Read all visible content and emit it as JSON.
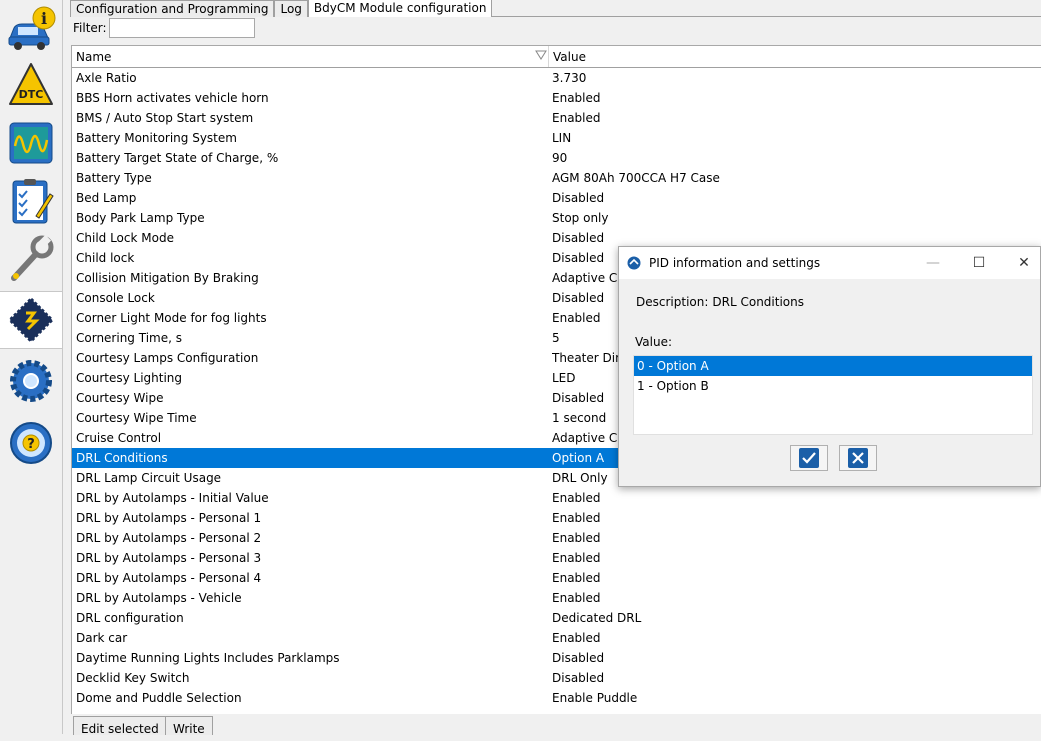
{
  "toolbar": {
    "items": [
      {
        "icon": "vehicle-info-icon"
      },
      {
        "icon": "dtc-icon",
        "label": "DTC"
      },
      {
        "icon": "oscilloscope-icon"
      },
      {
        "icon": "checklist-icon"
      },
      {
        "icon": "wrench-icon"
      },
      {
        "icon": "module-config-icon",
        "active": true
      },
      {
        "icon": "settings-gear-icon"
      },
      {
        "icon": "help-wheel-icon",
        "label": "?"
      }
    ]
  },
  "tabs": [
    {
      "label": "Configuration and Programming"
    },
    {
      "label": "Log"
    },
    {
      "label": "BdyCM Module configuration",
      "active": true
    }
  ],
  "filter": {
    "label": "Filter:",
    "value": ""
  },
  "table": {
    "columns": {
      "name": "Name",
      "value": "Value"
    },
    "rows": [
      {
        "name": "Axle Ratio",
        "value": "3.730"
      },
      {
        "name": "BBS Horn activates vehicle horn",
        "value": "Enabled"
      },
      {
        "name": "BMS / Auto Stop Start system",
        "value": "Enabled"
      },
      {
        "name": "Battery Monitoring System",
        "value": "LIN"
      },
      {
        "name": "Battery Target State of Charge, %",
        "value": "90"
      },
      {
        "name": "Battery Type",
        "value": "AGM 80Ah 700CCA H7 Case"
      },
      {
        "name": "Bed Lamp",
        "value": "Disabled"
      },
      {
        "name": "Body Park Lamp Type",
        "value": "Stop only"
      },
      {
        "name": "Child Lock Mode",
        "value": "Disabled"
      },
      {
        "name": "Child lock",
        "value": "Disabled"
      },
      {
        "name": "Collision Mitigation By Braking",
        "value": "Adaptive Cr"
      },
      {
        "name": "Console Lock",
        "value": "Disabled"
      },
      {
        "name": "Corner Light Mode for fog lights",
        "value": "Enabled"
      },
      {
        "name": "Cornering Time, s",
        "value": "5"
      },
      {
        "name": "Courtesy Lamps Configuration",
        "value": "Theater Dim"
      },
      {
        "name": "Courtesy Lighting",
        "value": "LED"
      },
      {
        "name": "Courtesy Wipe",
        "value": "Disabled"
      },
      {
        "name": "Courtesy Wipe Time",
        "value": "1 second"
      },
      {
        "name": "Cruise Control",
        "value": "Adaptive Cr"
      },
      {
        "name": "DRL Conditions",
        "value": "Option A",
        "selected": true
      },
      {
        "name": "DRL Lamp Circuit Usage",
        "value": "DRL Only"
      },
      {
        "name": "DRL by Autolamps - Initial Value",
        "value": "Enabled"
      },
      {
        "name": "DRL by Autolamps - Personal 1",
        "value": "Enabled"
      },
      {
        "name": "DRL by Autolamps - Personal 2",
        "value": "Enabled"
      },
      {
        "name": "DRL by Autolamps - Personal 3",
        "value": "Enabled"
      },
      {
        "name": "DRL by Autolamps - Personal 4",
        "value": "Enabled"
      },
      {
        "name": "DRL by Autolamps - Vehicle",
        "value": "Enabled"
      },
      {
        "name": "DRL configuration",
        "value": "Dedicated DRL"
      },
      {
        "name": "Dark car",
        "value": "Enabled"
      },
      {
        "name": "Daytime Running Lights Includes Parklamps",
        "value": "Disabled"
      },
      {
        "name": "Decklid Key Switch",
        "value": "Disabled"
      },
      {
        "name": "Dome and Puddle Selection",
        "value": "Enable Puddle"
      }
    ]
  },
  "bottom_buttons": {
    "edit": "Edit selected",
    "write": "Write"
  },
  "dialog": {
    "title": "PID information and settings",
    "description_label": "Description:",
    "description_value": "DRL Conditions",
    "value_label": "Value:",
    "options": [
      {
        "label": "0 - Option A",
        "selected": true
      },
      {
        "label": "1 - Option B"
      }
    ],
    "window_buttons": {
      "minimize": "—",
      "maximize": "☐",
      "close": "✕"
    }
  },
  "colors": {
    "selection": "#0078d7",
    "dialog_button": "#1b5fa8"
  }
}
